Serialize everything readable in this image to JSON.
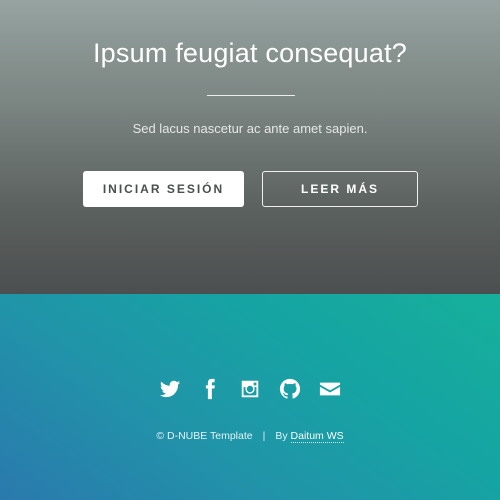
{
  "hero": {
    "title": "Ipsum feugiat consequat?",
    "subtitle": "Sed lacus nascetur ac ante amet sapien.",
    "primary_button": "INICIAR SESIÓN",
    "secondary_button": "LEER MÁS"
  },
  "footer": {
    "social_icons": [
      "twitter-icon",
      "facebook-icon",
      "instagram-icon",
      "github-icon",
      "envelope-icon"
    ],
    "copyright": "© D-NUBE Template",
    "separator": "|",
    "by_label": "By",
    "author_link": "Daitum WS"
  },
  "colors": {
    "hero_top": "#96a3a0",
    "hero_bottom": "#4b4f4f",
    "footer_start": "#2a79ad",
    "footer_end": "#16b09b"
  }
}
